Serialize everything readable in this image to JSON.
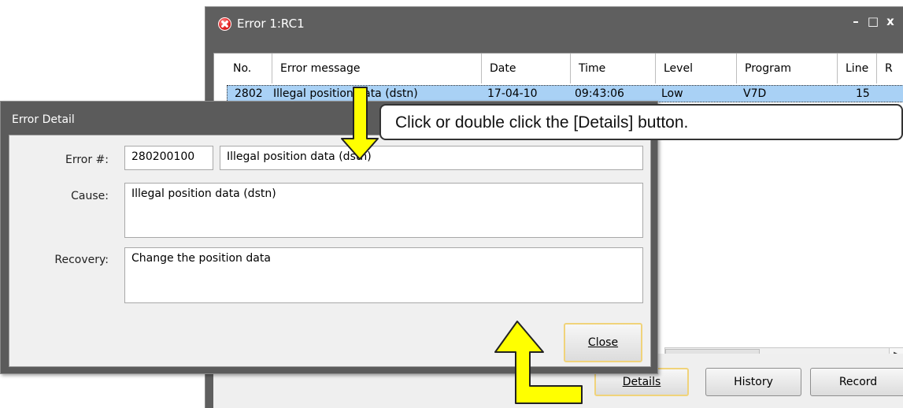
{
  "error_window": {
    "title": "Error 1:RC1",
    "controls": {
      "minimize": "–",
      "maximize": "□",
      "close": "x"
    },
    "columns": [
      "No.",
      "Error message",
      "Date",
      "Time",
      "Level",
      "Program",
      "Line",
      "R"
    ],
    "rows": [
      {
        "no": "2802",
        "message": "Illegal position data (dstn)",
        "date": "17-04-10",
        "time": "09:43:06",
        "level": "Low",
        "program": "V7D",
        "line": "15"
      }
    ],
    "buttons": {
      "details": "Details",
      "history": "History",
      "record": "Record"
    },
    "colors": {
      "selection": "#a9d1f5",
      "frame": "#5f5f5f"
    }
  },
  "error_detail": {
    "title": "Error Detail",
    "error_label": "Error #:",
    "error_code": "280200100",
    "error_message": "Illegal position data (dstn)",
    "cause_label": "Cause:",
    "cause": "Illegal position data (dstn)",
    "recovery_label": "Recovery:",
    "recovery": "Change the position data",
    "close_label": "Close"
  },
  "annotation": {
    "callout_text": "Click or double click the [Details] button.",
    "arrow_color": "#ffff00"
  }
}
